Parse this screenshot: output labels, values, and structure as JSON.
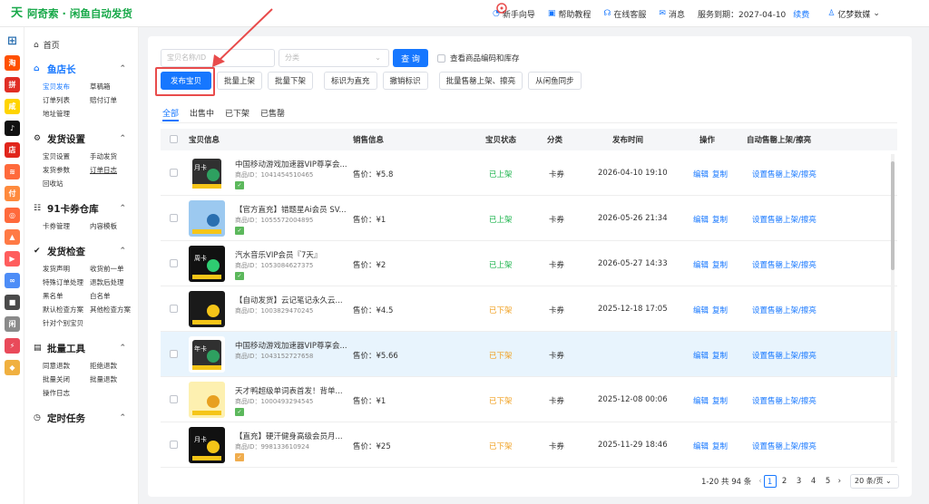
{
  "app": {
    "logo_glyph": "天",
    "title": "阿奇索 · 闲鱼自动发货"
  },
  "topnav": {
    "guide": "新手向导",
    "help": "帮助教程",
    "service": "在线客服",
    "messages": "消息",
    "expire": "服务到期：2027-04-10",
    "renew": "续费",
    "user": "亿梦数媒"
  },
  "rail": [
    {
      "t": "⊞",
      "c": "#2a6fb0"
    },
    {
      "t": "淘",
      "c": "#ff5000"
    },
    {
      "t": "拼",
      "c": "#e02e24"
    },
    {
      "t": "咸",
      "c": "#ffd400"
    },
    {
      "t": "♪",
      "c": "#111111"
    },
    {
      "t": "店",
      "c": "#e1251b"
    },
    {
      "t": "≋",
      "c": "#ff6a3c"
    },
    {
      "t": "付",
      "c": "#ff8a3d"
    },
    {
      "t": "◎",
      "c": "#ff6a3c"
    },
    {
      "t": "▲",
      "c": "#ff7a45"
    },
    {
      "t": "▶",
      "c": "#ff5d5d"
    },
    {
      "t": "∞",
      "c": "#4d8df7"
    },
    {
      "t": "■",
      "c": "#4a4a4a"
    },
    {
      "t": "闲",
      "c": "#8a8a8a"
    },
    {
      "t": "⚡",
      "c": "#e94a5a"
    },
    {
      "t": "◆",
      "c": "#f0b040"
    }
  ],
  "sidebar": {
    "home": "首页",
    "sections": [
      {
        "title": "鱼店长",
        "active": true,
        "items": [
          "宝贝发布",
          "草稿箱",
          "订单列表",
          "赔付订单",
          "地址管理"
        ]
      },
      {
        "title": "发货设置",
        "items": [
          "宝贝设置",
          "手动发货",
          "发货参数",
          "订单日志",
          "回收站"
        ]
      },
      {
        "title": "91卡券仓库",
        "items": [
          "卡券管理",
          "内容模板"
        ]
      },
      {
        "title": "发货检查",
        "items": [
          "发货声明",
          "收货前一单",
          "特殊订单处理",
          "退款后处理",
          "黑名单",
          "白名单",
          "默认检查方案",
          "其他检查方案",
          "针对个别宝贝"
        ]
      },
      {
        "title": "批量工具",
        "items": [
          "同意退款",
          "拒绝退款",
          "批量关闭",
          "批量退款",
          "操作日志"
        ]
      },
      {
        "title": "定时任务",
        "items": []
      }
    ]
  },
  "filters": {
    "name_placeholder": "宝贝名称/ID",
    "category_placeholder": "分类",
    "query": "查 询",
    "show_code": "查看商品编码和库存"
  },
  "actions": [
    "发布宝贝",
    "批量上架",
    "批量下架",
    "标识为直充",
    "撤销标识",
    "批量售罄上架、擦亮",
    "从闲鱼同步"
  ],
  "tabs": [
    "全部",
    "出售中",
    "已下架",
    "已售罄"
  ],
  "columns": [
    "宝贝信息",
    "销售信息",
    "宝贝状态",
    "分类",
    "发布时间",
    "操作",
    "自动售罄上架/擦亮"
  ],
  "rows": [
    {
      "name": "中国移动游戏加速器VIP尊享会...",
      "id": "商品ID：1041454510465",
      "price": "售价：¥5.8",
      "status": "已上架",
      "on": true,
      "cat": "卡券",
      "date": "2026-04-10 19:10",
      "tag_c": "#5cb85c",
      "thumb": "month_cmcc"
    },
    {
      "name": "【官方直充】错题星Ai会员 SV...",
      "id": "商品ID：1055572004895",
      "price": "售价：¥1",
      "status": "已上架",
      "on": true,
      "cat": "卡券",
      "date": "2026-05-26 21:34",
      "tag_c": "#5cb85c",
      "thumb": "blue"
    },
    {
      "name": "汽水音乐VIP会员『7天』",
      "id": "商品ID：1053084627375",
      "price": "售价：¥2",
      "status": "已上架",
      "on": true,
      "cat": "卡券",
      "date": "2026-05-27 14:33",
      "tag_c": "#5cb85c",
      "thumb": "week_music"
    },
    {
      "name": "【自动发货】云记笔记永久云...",
      "id": "商品ID：1003829470245",
      "price": "售价：¥4.5",
      "status": "已下架",
      "on": false,
      "cat": "卡券",
      "date": "2025-12-18 17:05",
      "tag_c": "",
      "thumb": "dark"
    },
    {
      "name": "中国移动游戏加速器VIP尊享会...",
      "id": "商品ID：1043152727658",
      "price": "售价：¥5.66",
      "status": "已下架",
      "on": false,
      "cat": "卡券",
      "date": "",
      "tag_c": "",
      "thumb": "year_cmcc"
    },
    {
      "name": "天才鸭超级单词表首发！背单...",
      "id": "商品ID：1000493294545",
      "price": "售价：¥1",
      "status": "已下架",
      "on": false,
      "cat": "卡券",
      "date": "2025-12-08 00:06",
      "tag_c": "#5cb85c",
      "thumb": "yellow"
    },
    {
      "name": "【直充】硬汗健身高级会员月...",
      "id": "商品ID：998133610924",
      "price": "售价：¥25",
      "status": "已下架",
      "on": false,
      "cat": "卡券",
      "date": "2025-11-29 18:46",
      "tag_c": "#f0ad4e",
      "thumb": "month_fit"
    }
  ],
  "row_ops": {
    "edit": "编辑",
    "copy": "复制",
    "auto": "设置售罄上架/擦亮"
  },
  "pager": {
    "total": "1-20 共 94 条",
    "pages": [
      "1",
      "2",
      "3",
      "4",
      "5"
    ],
    "current": "1",
    "size": "20 条/页"
  }
}
